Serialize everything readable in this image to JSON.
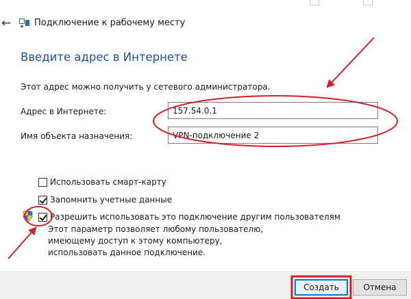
{
  "window": {
    "title": "Подключение к рабочему месту"
  },
  "page": {
    "heading": "Введите адрес в Интернете",
    "info": "Этот адрес можно получить у сетевого администратора."
  },
  "form": {
    "address_label": "Адрес в Интернете:",
    "address_value": "157.54.0.1",
    "destination_label": "Имя объекта назначения:",
    "destination_value": "VPN-подключение 2"
  },
  "options": {
    "smartcard_label": "Использовать смарт-карту",
    "smartcard_checked": false,
    "remember_label": "Запомнить учетные данные",
    "remember_checked": true,
    "share_label": "Разрешить использовать это подключение другим пользователям",
    "share_checked": true,
    "share_desc": "Этот параметр позволяет любому пользователю, имеющему доступ к этому компьютеру, использовать данное подключение."
  },
  "buttons": {
    "create_label": "Создать",
    "cancel_label": "Отмена"
  },
  "colors": {
    "heading": "#1e4fa0",
    "annotation": "#d0202a",
    "focus": "#0078d7",
    "footer": "#f0f0f0"
  },
  "icons": {
    "back": "back-arrow-icon",
    "app": "network-icon",
    "shield": "uac-shield-icon"
  }
}
